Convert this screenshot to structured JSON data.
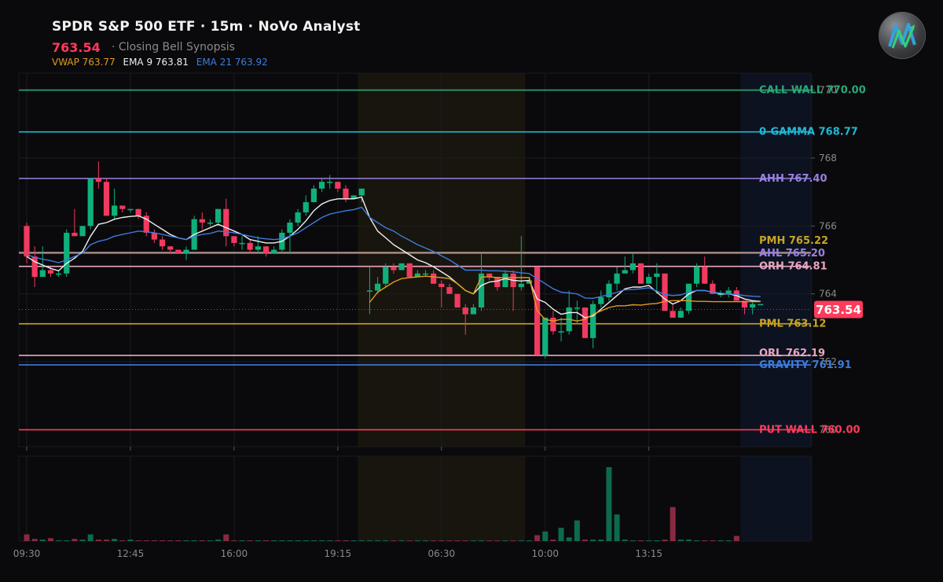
{
  "header": {
    "title": "SPDR S&P 500 ETF · 15m · NoVo Analyst",
    "price": "763.54",
    "subtitle": "· Closing Bell Synopsis",
    "indicators": [
      {
        "label": "VWAP 763.77",
        "color": "#e39a1c"
      },
      {
        "label": "EMA 9 763.81",
        "color": "#f0f0f0"
      },
      {
        "label": "EMA 21 763.92",
        "color": "#3d7bdc"
      }
    ]
  },
  "logo": {
    "icon": "novo-logo-icon"
  },
  "chart_data": {
    "type": "candlestick",
    "ylim": [
      759.5,
      770.5
    ],
    "y_ticks": [
      760,
      762,
      764,
      766,
      768,
      770
    ],
    "y_tick_labels": [
      "760",
      "762",
      "764",
      "766",
      "768",
      "770"
    ],
    "x_tick_labels": [
      "09:30",
      "12:45",
      "16:00",
      "19:15",
      "06:30",
      "10:00",
      "13:15"
    ],
    "x_tick_index": [
      0,
      13,
      26,
      39,
      52,
      65,
      78
    ],
    "last_price": 763.54,
    "last_price_label": "763.54",
    "levels": [
      {
        "label": "CALL WALL 770.00",
        "value": 770.0,
        "color": "#2aa876"
      },
      {
        "label": "0-GAMMA 768.77",
        "value": 768.77,
        "color": "#22b8d4"
      },
      {
        "label": "AHH 767.40",
        "value": 767.4,
        "color": "#9a80e0"
      },
      {
        "label": "PMH 765.22",
        "value": 765.22,
        "color": "#c9a422",
        "label_offset": -15
      },
      {
        "label": "AHL 765.20",
        "value": 765.2,
        "color": "#9a80e0"
      },
      {
        "label": "ORH 764.81",
        "value": 764.81,
        "color": "#e9a6c1"
      },
      {
        "label": "PML 763.12",
        "value": 763.12,
        "color": "#c9a422"
      },
      {
        "label": "ORL 762.19",
        "value": 762.19,
        "color": "#e9a6c1",
        "label_offset": -3
      },
      {
        "label": "GRAVITY 761.91",
        "value": 761.91,
        "color": "#3d7bdc"
      },
      {
        "label": "PUT WALL 760.00",
        "value": 760.0,
        "color": "#ff3b5c"
      }
    ],
    "sessions": [
      {
        "name": "premarket",
        "start": 42,
        "end": 63,
        "color": "#17150d"
      },
      {
        "name": "afterhours",
        "start": 90,
        "end": 99,
        "color": "#0c1220"
      }
    ],
    "candles": [
      [
        766.0,
        765.1,
        766.1,
        764.9
      ],
      [
        765.1,
        764.5,
        765.4,
        764.2
      ],
      [
        764.5,
        764.7,
        765.4,
        764.6
      ],
      [
        764.7,
        764.6,
        764.8,
        764.5
      ],
      [
        764.6,
        764.6,
        764.7,
        764.5
      ],
      [
        764.6,
        765.8,
        765.9,
        764.5
      ],
      [
        765.8,
        765.7,
        766.5,
        765.7
      ],
      [
        765.7,
        766.0,
        766.0,
        765.8
      ],
      [
        766.0,
        767.4,
        767.4,
        765.9
      ],
      [
        767.4,
        767.3,
        767.9,
        767.1
      ],
      [
        767.3,
        766.3,
        767.4,
        766.3
      ],
      [
        766.3,
        766.6,
        767.1,
        766.2
      ],
      [
        766.6,
        766.5,
        766.6,
        766.4
      ],
      [
        766.5,
        766.5,
        766.5,
        766.4
      ],
      [
        766.5,
        766.3,
        766.5,
        766.2
      ],
      [
        766.3,
        765.8,
        766.4,
        765.7
      ],
      [
        765.8,
        765.6,
        765.9,
        765.5
      ],
      [
        765.6,
        765.4,
        765.7,
        765.3
      ],
      [
        765.4,
        765.3,
        765.4,
        765.2
      ],
      [
        765.3,
        765.2,
        765.3,
        765.2
      ],
      [
        765.2,
        765.3,
        765.4,
        765.0
      ],
      [
        765.3,
        766.2,
        766.3,
        765.3
      ],
      [
        766.2,
        766.1,
        766.4,
        765.9
      ],
      [
        766.1,
        766.1,
        766.2,
        766.0
      ],
      [
        766.1,
        766.5,
        766.5,
        766.0
      ],
      [
        766.5,
        765.7,
        766.8,
        765.4
      ],
      [
        765.7,
        765.5,
        765.7,
        765.4
      ],
      [
        765.5,
        765.5,
        765.7,
        765.3
      ],
      [
        765.5,
        765.3,
        765.6,
        765.2
      ],
      [
        765.3,
        765.4,
        765.7,
        765.2
      ],
      [
        765.4,
        765.2,
        765.4,
        765.1
      ],
      [
        765.2,
        765.3,
        765.4,
        765.2
      ],
      [
        765.3,
        765.8,
        765.9,
        765.2
      ],
      [
        765.8,
        766.1,
        766.2,
        765.2
      ],
      [
        766.1,
        766.4,
        766.5,
        766.0
      ],
      [
        766.4,
        766.7,
        766.9,
        766.3
      ],
      [
        766.7,
        767.1,
        767.2,
        766.7
      ],
      [
        767.1,
        767.3,
        767.4,
        767.0
      ],
      [
        767.3,
        767.3,
        767.5,
        767.1
      ],
      [
        767.3,
        767.1,
        767.3,
        767.0
      ],
      [
        767.1,
        766.8,
        767.2,
        766.7
      ],
      [
        766.8,
        766.9,
        766.9,
        766.8
      ],
      [
        766.9,
        767.1,
        767.1,
        766.7
      ],
      [
        764.1,
        764.1,
        764.8,
        763.4
      ],
      [
        764.1,
        764.3,
        764.5,
        764.0
      ],
      [
        764.3,
        764.8,
        764.9,
        764.2
      ],
      [
        764.8,
        764.7,
        764.9,
        764.6
      ],
      [
        764.7,
        764.9,
        764.9,
        764.7
      ],
      [
        764.9,
        764.5,
        764.9,
        764.5
      ],
      [
        764.5,
        764.6,
        764.7,
        764.5
      ],
      [
        764.6,
        764.6,
        764.7,
        764.5
      ],
      [
        764.6,
        764.3,
        764.7,
        764.3
      ],
      [
        764.3,
        764.2,
        764.4,
        763.6
      ],
      [
        764.2,
        764.0,
        764.3,
        764.0
      ],
      [
        764.0,
        763.6,
        764.0,
        763.6
      ],
      [
        763.6,
        763.4,
        763.7,
        762.8
      ],
      [
        763.4,
        763.6,
        763.7,
        763.4
      ],
      [
        763.6,
        764.6,
        765.2,
        763.5
      ],
      [
        764.6,
        764.5,
        764.6,
        764.4
      ],
      [
        764.5,
        764.2,
        764.5,
        764.1
      ],
      [
        764.2,
        764.6,
        764.7,
        764.2
      ],
      [
        764.6,
        764.2,
        764.7,
        763.5
      ],
      [
        764.2,
        764.3,
        765.7,
        764.1
      ],
      [
        764.3,
        764.4,
        764.5,
        764.3
      ],
      [
        764.8,
        762.2,
        764.8,
        762.2
      ],
      [
        762.2,
        763.3,
        763.3,
        762.1
      ],
      [
        763.3,
        762.9,
        763.5,
        762.8
      ],
      [
        762.9,
        762.9,
        763.3,
        762.6
      ],
      [
        762.9,
        763.6,
        764.1,
        762.8
      ],
      [
        763.6,
        763.6,
        763.8,
        763.1
      ],
      [
        763.6,
        762.7,
        763.6,
        762.7
      ],
      [
        762.7,
        763.7,
        763.8,
        762.4
      ],
      [
        763.7,
        763.9,
        764.1,
        763.6
      ],
      [
        763.9,
        764.3,
        764.4,
        763.8
      ],
      [
        764.3,
        764.6,
        764.8,
        764.1
      ],
      [
        764.6,
        764.7,
        765.1,
        764.6
      ],
      [
        764.7,
        764.9,
        765.2,
        764.6
      ],
      [
        764.9,
        764.3,
        764.9,
        764.3
      ],
      [
        764.3,
        764.5,
        764.6,
        764.3
      ],
      [
        764.5,
        764.6,
        764.9,
        764.0
      ],
      [
        764.6,
        763.5,
        764.6,
        763.5
      ],
      [
        763.5,
        763.3,
        763.7,
        763.3
      ],
      [
        763.3,
        763.5,
        763.6,
        763.3
      ],
      [
        763.5,
        764.3,
        764.3,
        763.4
      ],
      [
        764.3,
        764.8,
        764.9,
        764.2
      ],
      [
        764.8,
        764.3,
        765.1,
        764.3
      ],
      [
        764.3,
        764.0,
        764.4,
        764.0
      ],
      [
        764.0,
        764.0,
        764.1,
        763.9
      ],
      [
        764.0,
        764.1,
        764.2,
        763.9
      ],
      [
        764.1,
        763.8,
        764.2,
        763.8
      ],
      [
        763.8,
        763.6,
        763.8,
        763.4
      ],
      [
        763.6,
        763.7,
        763.8,
        763.4
      ],
      [
        763.7,
        763.7,
        763.7,
        763.7
      ]
    ],
    "volume": [
      9,
      3,
      2,
      4,
      1,
      1,
      3,
      2,
      9,
      2,
      2,
      3,
      1,
      2,
      1,
      1,
      1,
      1,
      1,
      1,
      1,
      1,
      1,
      1,
      2,
      9,
      1,
      1,
      1,
      1,
      1,
      1,
      1,
      1,
      1,
      1,
      1,
      1,
      1,
      1,
      1,
      1,
      1,
      1,
      1,
      1,
      1,
      1,
      1,
      1,
      1,
      1,
      1,
      1,
      1,
      1,
      1,
      1,
      1,
      1,
      1,
      1,
      1,
      1,
      8,
      13,
      2,
      18,
      5,
      28,
      2,
      2,
      2,
      100,
      36,
      2,
      1,
      1,
      1,
      1,
      2,
      46,
      2,
      2,
      1,
      1,
      1,
      1,
      1,
      7
    ],
    "series": [
      {
        "name": "EMA 9",
        "color": "#f0f0f0",
        "values": [
          765.1,
          764.95,
          764.85,
          764.75,
          764.68,
          764.9,
          765.05,
          765.25,
          765.7,
          766.05,
          766.1,
          766.2,
          766.25,
          766.28,
          766.3,
          766.2,
          766.05,
          765.9,
          765.75,
          765.65,
          765.6,
          765.75,
          765.85,
          765.95,
          766.05,
          765.95,
          765.85,
          765.75,
          765.6,
          765.55,
          765.5,
          765.5,
          765.55,
          765.7,
          765.9,
          766.15,
          766.45,
          766.65,
          766.75,
          766.8,
          766.8,
          766.8,
          766.85,
          766.25,
          765.85,
          765.65,
          765.45,
          765.3,
          765.15,
          765.0,
          764.92,
          764.8,
          764.65,
          764.5,
          764.3,
          764.1,
          764.0,
          764.25,
          764.35,
          764.38,
          764.45,
          764.4,
          764.38,
          764.4,
          763.85,
          763.75,
          763.55,
          763.4,
          763.45,
          763.45,
          763.3,
          763.35,
          763.55,
          763.75,
          763.95,
          764.15,
          764.2,
          764.2,
          764.25,
          764.05,
          763.85,
          763.7,
          763.8,
          764.0,
          764.1,
          764.1,
          764.05,
          764.0,
          764.0,
          763.95,
          763.85,
          763.8,
          763.78
        ]
      },
      {
        "name": "EMA 21",
        "color": "#3d7bdc",
        "values": [
          765.15,
          765.08,
          765.02,
          764.98,
          764.92,
          765.0,
          765.1,
          765.2,
          765.45,
          765.55,
          765.6,
          765.7,
          765.75,
          765.8,
          765.85,
          765.83,
          765.8,
          765.75,
          765.7,
          765.65,
          765.6,
          765.7,
          765.75,
          765.78,
          765.85,
          765.83,
          765.8,
          765.75,
          765.7,
          765.65,
          765.62,
          765.6,
          765.62,
          765.7,
          765.8,
          765.95,
          766.1,
          766.25,
          766.35,
          766.4,
          766.45,
          766.48,
          766.55,
          766.25,
          766.1,
          765.95,
          765.85,
          765.7,
          765.58,
          765.45,
          765.35,
          765.25,
          765.12,
          765.0,
          764.85,
          764.7,
          764.7,
          764.7,
          764.68,
          764.68,
          764.67,
          764.65,
          764.62,
          764.6,
          764.45,
          764.3,
          764.15,
          764.05,
          764.03,
          764.0,
          763.88,
          763.87,
          763.92,
          763.98,
          764.05,
          764.12,
          764.13,
          764.15,
          764.18,
          764.08,
          763.98,
          763.95,
          763.97,
          764.05,
          764.1,
          764.1,
          764.05,
          764.02,
          764.0,
          763.98,
          763.95,
          763.93,
          763.92
        ]
      },
      {
        "name": "VWAP",
        "color": "#e39a1c",
        "start": 43,
        "values": [
          763.75,
          764.05,
          764.2,
          764.35,
          764.45,
          764.48,
          764.5,
          764.52,
          764.5,
          764.48,
          764.45,
          764.3,
          764.1,
          764.0,
          764.5,
          764.5,
          764.48,
          764.48,
          764.48,
          764.48,
          764.48,
          763.5,
          763.25,
          763.2,
          763.25,
          763.25,
          763.2,
          763.25,
          763.4,
          763.5,
          763.6,
          763.65,
          763.65,
          763.68,
          763.67,
          763.7,
          763.72,
          763.78,
          763.8,
          763.8,
          763.8,
          763.78,
          763.78,
          763.77,
          763.77,
          763.77,
          763.77,
          763.77,
          763.77,
          763.77
        ]
      }
    ]
  }
}
